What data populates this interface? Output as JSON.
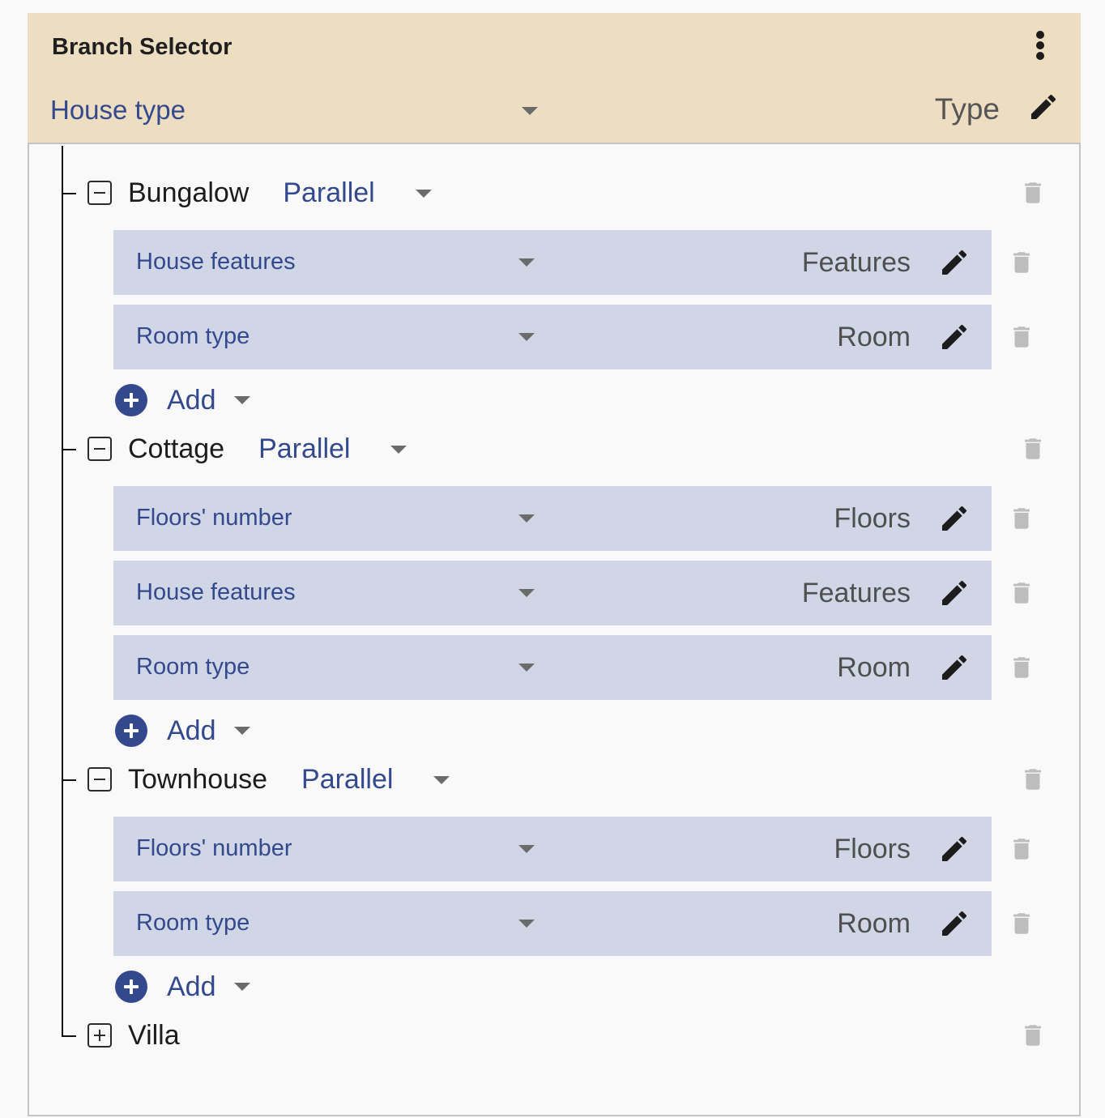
{
  "header": {
    "title": "Branch Selector",
    "menu_icon": "more-vertical-icon",
    "selector": {
      "value": "House type",
      "icon": "caret-down-icon"
    },
    "name": "Type",
    "edit_icon": "pencil-icon"
  },
  "colors": {
    "header_bg": "#eddec2",
    "row_bg": "#d0d6e6",
    "accent": "#34498d",
    "trash": "#bdbdbd"
  },
  "branches": [
    {
      "label": "Bungalow",
      "expanded": true,
      "toggle_icon": "collapse-minus-icon",
      "mode": "Parallel",
      "rows": [
        {
          "selector": "House features",
          "name": "Features"
        },
        {
          "selector": "Room type",
          "name": "Room"
        }
      ],
      "add_label": "Add"
    },
    {
      "label": "Cottage",
      "expanded": true,
      "toggle_icon": "collapse-minus-icon",
      "mode": "Parallel",
      "rows": [
        {
          "selector": "Floors' number",
          "name": "Floors"
        },
        {
          "selector": "House features",
          "name": "Features"
        },
        {
          "selector": "Room type",
          "name": "Room"
        }
      ],
      "add_label": "Add"
    },
    {
      "label": "Townhouse",
      "expanded": true,
      "toggle_icon": "collapse-minus-icon",
      "mode": "Parallel",
      "rows": [
        {
          "selector": "Floors' number",
          "name": "Floors"
        },
        {
          "selector": "Room type",
          "name": "Room"
        }
      ],
      "add_label": "Add"
    },
    {
      "label": "Villa",
      "expanded": false,
      "toggle_icon": "expand-plus-icon"
    }
  ]
}
